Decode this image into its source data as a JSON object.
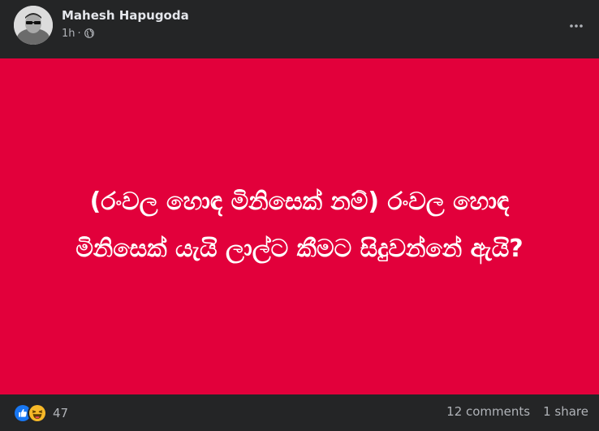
{
  "post": {
    "author": "Mahesh Hapugoda",
    "time": "1h",
    "separator": "·",
    "audience_icon": "globe-icon",
    "text_line_1": "(රංවල හොඳ මිනිසෙක් නම්) රංවල හොඳ",
    "text_line_2": "මිනිසෙක් යැයි ලාල්ට කීමට සිදුවන්නේ ඇයි?",
    "background_color": "#e2003b"
  },
  "footer": {
    "reaction_icons": [
      "like-icon",
      "haha-icon"
    ],
    "reaction_count": "47",
    "comments": "12 comments",
    "shares": "1 share"
  },
  "colors": {
    "card_bg": "#242526",
    "primary_text": "#e4e6eb",
    "secondary_text": "#b0b3b8",
    "like_blue": "#1877f2",
    "haha_yellow": "#f7b928"
  }
}
